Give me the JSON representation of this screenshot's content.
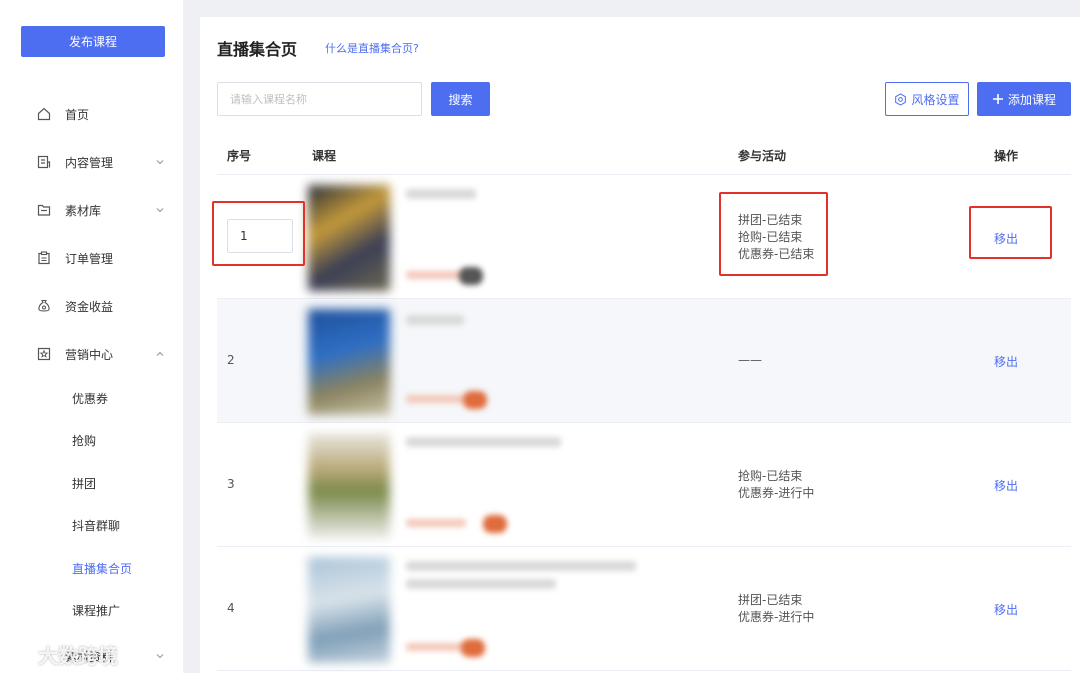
{
  "sidebar": {
    "publish_label": "发布课程",
    "items": [
      {
        "label": "首页",
        "icon": "home-icon"
      },
      {
        "label": "内容管理",
        "icon": "content-icon"
      },
      {
        "label": "素材库",
        "icon": "folder-icon"
      },
      {
        "label": "订单管理",
        "icon": "clipboard-icon"
      },
      {
        "label": "资金收益",
        "icon": "money-bag-icon"
      },
      {
        "label": "营销中心",
        "icon": "marketing-icon"
      }
    ],
    "marketing_sub": [
      {
        "label": "优惠券"
      },
      {
        "label": "抢购"
      },
      {
        "label": "拼团"
      },
      {
        "label": "抖音群聊"
      },
      {
        "label": "直播集合页",
        "active": true
      },
      {
        "label": "课程推广"
      }
    ],
    "partial_item_label": "素材资料"
  },
  "page": {
    "title": "直播集合页",
    "help_link": "什么是直播集合页?"
  },
  "toolbar": {
    "search_placeholder": "请输入课程名称",
    "search_label": "搜索",
    "style_label": "风格设置",
    "add_label": "添加课程"
  },
  "table": {
    "headers": [
      "序号",
      "课程",
      "参与活动",
      "操作"
    ],
    "rows": [
      {
        "index": "1",
        "activities": [
          "拼团-已结束",
          "抢购-已结束",
          "优惠券-已结束"
        ],
        "action": "移出"
      },
      {
        "index": "2",
        "activities": [
          "——"
        ],
        "action": "移出"
      },
      {
        "index": "3",
        "activities": [
          "抢购-已结束",
          "优惠券-进行中"
        ],
        "action": "移出"
      },
      {
        "index": "4",
        "activities": [
          "拼团-已结束",
          "优惠券-进行中"
        ],
        "action": "移出"
      }
    ]
  },
  "watermark": "大数跨境",
  "colors": {
    "accent": "#4e6ef2",
    "highlight": "#e0312b"
  }
}
